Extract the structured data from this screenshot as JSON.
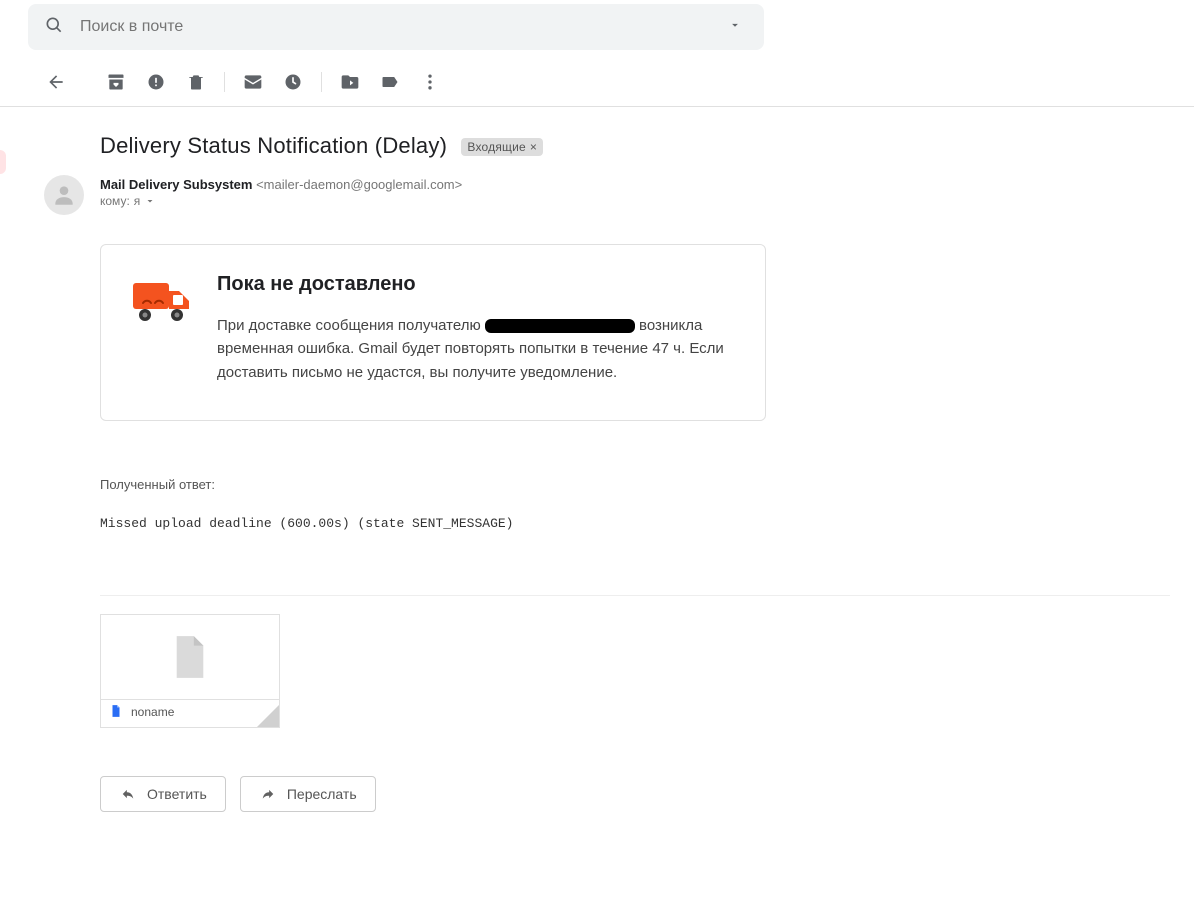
{
  "search": {
    "placeholder": "Поиск в почте"
  },
  "subject": "Delivery Status Notification (Delay)",
  "chip": {
    "label": "Входящие",
    "close": "×"
  },
  "sender": {
    "name": "Mail Delivery Subsystem",
    "email": "<mailer-daemon@googlemail.com>"
  },
  "recipient": {
    "prefix": "кому:",
    "value": "я"
  },
  "body": {
    "heading": "Пока не доставлено",
    "line1_prefix": "При доставке сообщения получателю",
    "line2": " возникла временная ошибка. Gmail будет повторять попытки в течение 47 ч. Если доставить письмо не удастся, вы получите уведомление."
  },
  "response_label": "Полученный ответ:",
  "response_code": "Missed upload deadline (600.00s) (state SENT_MESSAGE)",
  "attachment": {
    "name": "noname"
  },
  "actions": {
    "reply": "Ответить",
    "forward": "Переслать"
  }
}
